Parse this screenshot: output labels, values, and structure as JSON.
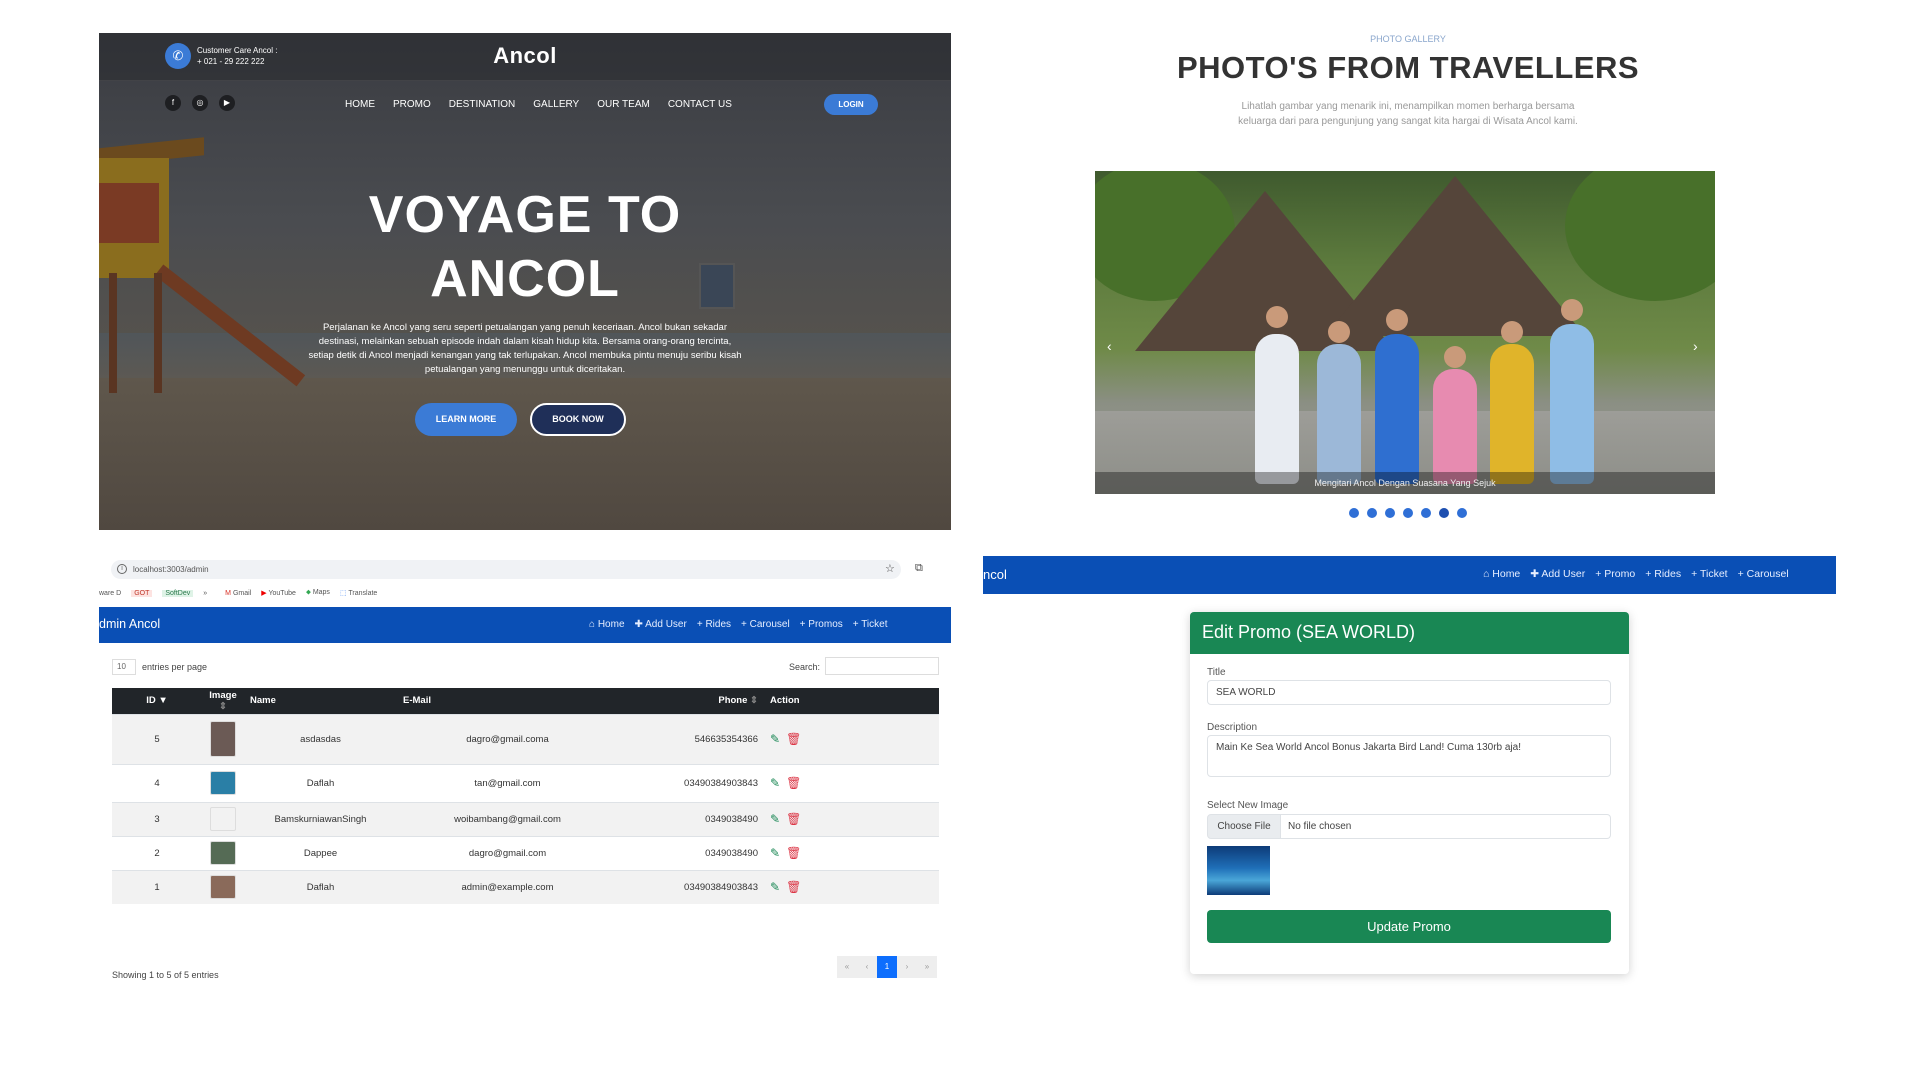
{
  "landing": {
    "care_label": "Customer Care Ancol :",
    "care_phone": "+ 021 - 29 222 222",
    "brand": "Ancol",
    "nav": [
      "HOME",
      "PROMO",
      "DESTINATION",
      "GALLERY",
      "OUR TEAM",
      "CONTACT US"
    ],
    "login": "LOGIN",
    "hero_line1": "VOYAGE TO",
    "hero_line2": "ANCOL",
    "hero_desc": "Perjalanan ke Ancol yang seru seperti petualangan yang penuh keceriaan. Ancol bukan sekadar destinasi, melainkan sebuah episode indah dalam kisah hidup kita. Bersama orang-orang tercinta, setiap detik di Ancol menjadi kenangan yang tak terlupakan. Ancol membuka pintu menuju seribu kisah petualangan yang menunggu untuk diceritakan.",
    "learn_more": "LEARN MORE",
    "book_now": "BOOK NOW",
    "social_icons": [
      "facebook-icon",
      "instagram-icon",
      "youtube-icon"
    ]
  },
  "gallery": {
    "kicker": "PHOTO GALLERY",
    "title": "PHOTO'S FROM TRAVELLERS",
    "desc": "Lihatlah gambar yang menarik ini, menampilkan momen berharga bersama keluarga dari para pengunjung yang sangat kita hargai di Wisata Ancol kami.",
    "caption": "Mengitari Ancol Dengan Suasana Yang Sejuk",
    "slide_count": 7,
    "active_slide": 6
  },
  "browser": {
    "url": "localhost:3003/admin",
    "bookmarks": [
      "ware D",
      "GOT",
      "SoftDev",
      "»",
      "Gmail",
      "YouTube",
      "Maps",
      "Translate"
    ]
  },
  "admin_users": {
    "title": "dmin Ancol",
    "nav": [
      "Home",
      "Add User",
      "Rides",
      "Carousel",
      "Promos",
      "Ticket"
    ],
    "entries_value": "10",
    "entries_label": "entries per page",
    "search_label": "Search:",
    "columns": [
      "ID",
      "Image",
      "Name",
      "E-Mail",
      "Phone",
      "Action"
    ],
    "rows": [
      {
        "id": "5",
        "name": "asdasdas",
        "email": "dagro@gmail.coma",
        "phone": "546635354366",
        "thumb": "#6b5a55"
      },
      {
        "id": "4",
        "name": "Daflah",
        "email": "tan@gmail.com",
        "phone": "03490384903843",
        "thumb": "#2a7fa6"
      },
      {
        "id": "3",
        "name": "BamskurniawanSingh",
        "email": "woibambang@gmail.com",
        "phone": "0349038490",
        "thumb": "#f2f2f2"
      },
      {
        "id": "2",
        "name": "Dappee",
        "email": "dagro@gmail.com",
        "phone": "0349038490",
        "thumb": "#556b55"
      },
      {
        "id": "1",
        "name": "Daflah",
        "email": "admin@example.com",
        "phone": "03490384903843",
        "thumb": "#8a6a5a"
      }
    ],
    "info": "Showing 1 to 5 of 5 entries",
    "pager": [
      "«",
      "‹",
      "1",
      "›",
      "»"
    ]
  },
  "edit_promo": {
    "title": "ncol",
    "nav": [
      "Home",
      "Add User",
      "Promo",
      "Rides",
      "Ticket",
      "Carousel"
    ],
    "card_title": "Edit Promo (SEA WORLD)",
    "title_label": "Title",
    "title_value": "SEA WORLD",
    "desc_label": "Description",
    "desc_value": "Main Ke Sea World Ancol Bonus Jakarta Bird Land! Cuma 130rb aja!",
    "image_label": "Select New Image",
    "choose_file": "Choose File",
    "no_file": "No file chosen",
    "update": "Update Promo"
  },
  "colors": {
    "brand_blue": "#0a4fb5",
    "accent_blue": "#3b7bd6",
    "success_green": "#198754",
    "danger_red": "#dc3545"
  }
}
